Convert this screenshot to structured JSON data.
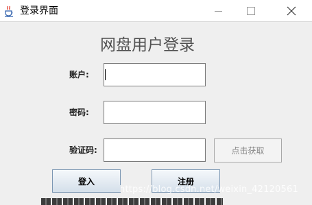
{
  "window": {
    "title": "登录界面",
    "icon": "java-coffee-cup-icon"
  },
  "form": {
    "heading": "网盘用户登录",
    "account_label": "账户:",
    "password_label": "密码:",
    "captcha_label": "验证码:",
    "account_value": "",
    "password_value": "",
    "captcha_value": "",
    "get_code_label": "点击获取"
  },
  "buttons": {
    "login_label": "登入",
    "register_label": "注册"
  },
  "watermark": {
    "text": "https://blog.csdn.net/weixin_42120561"
  },
  "colors": {
    "window_bg": "#efefef",
    "titlebar_bg": "#ffffff",
    "button_border": "#7c97b3"
  }
}
